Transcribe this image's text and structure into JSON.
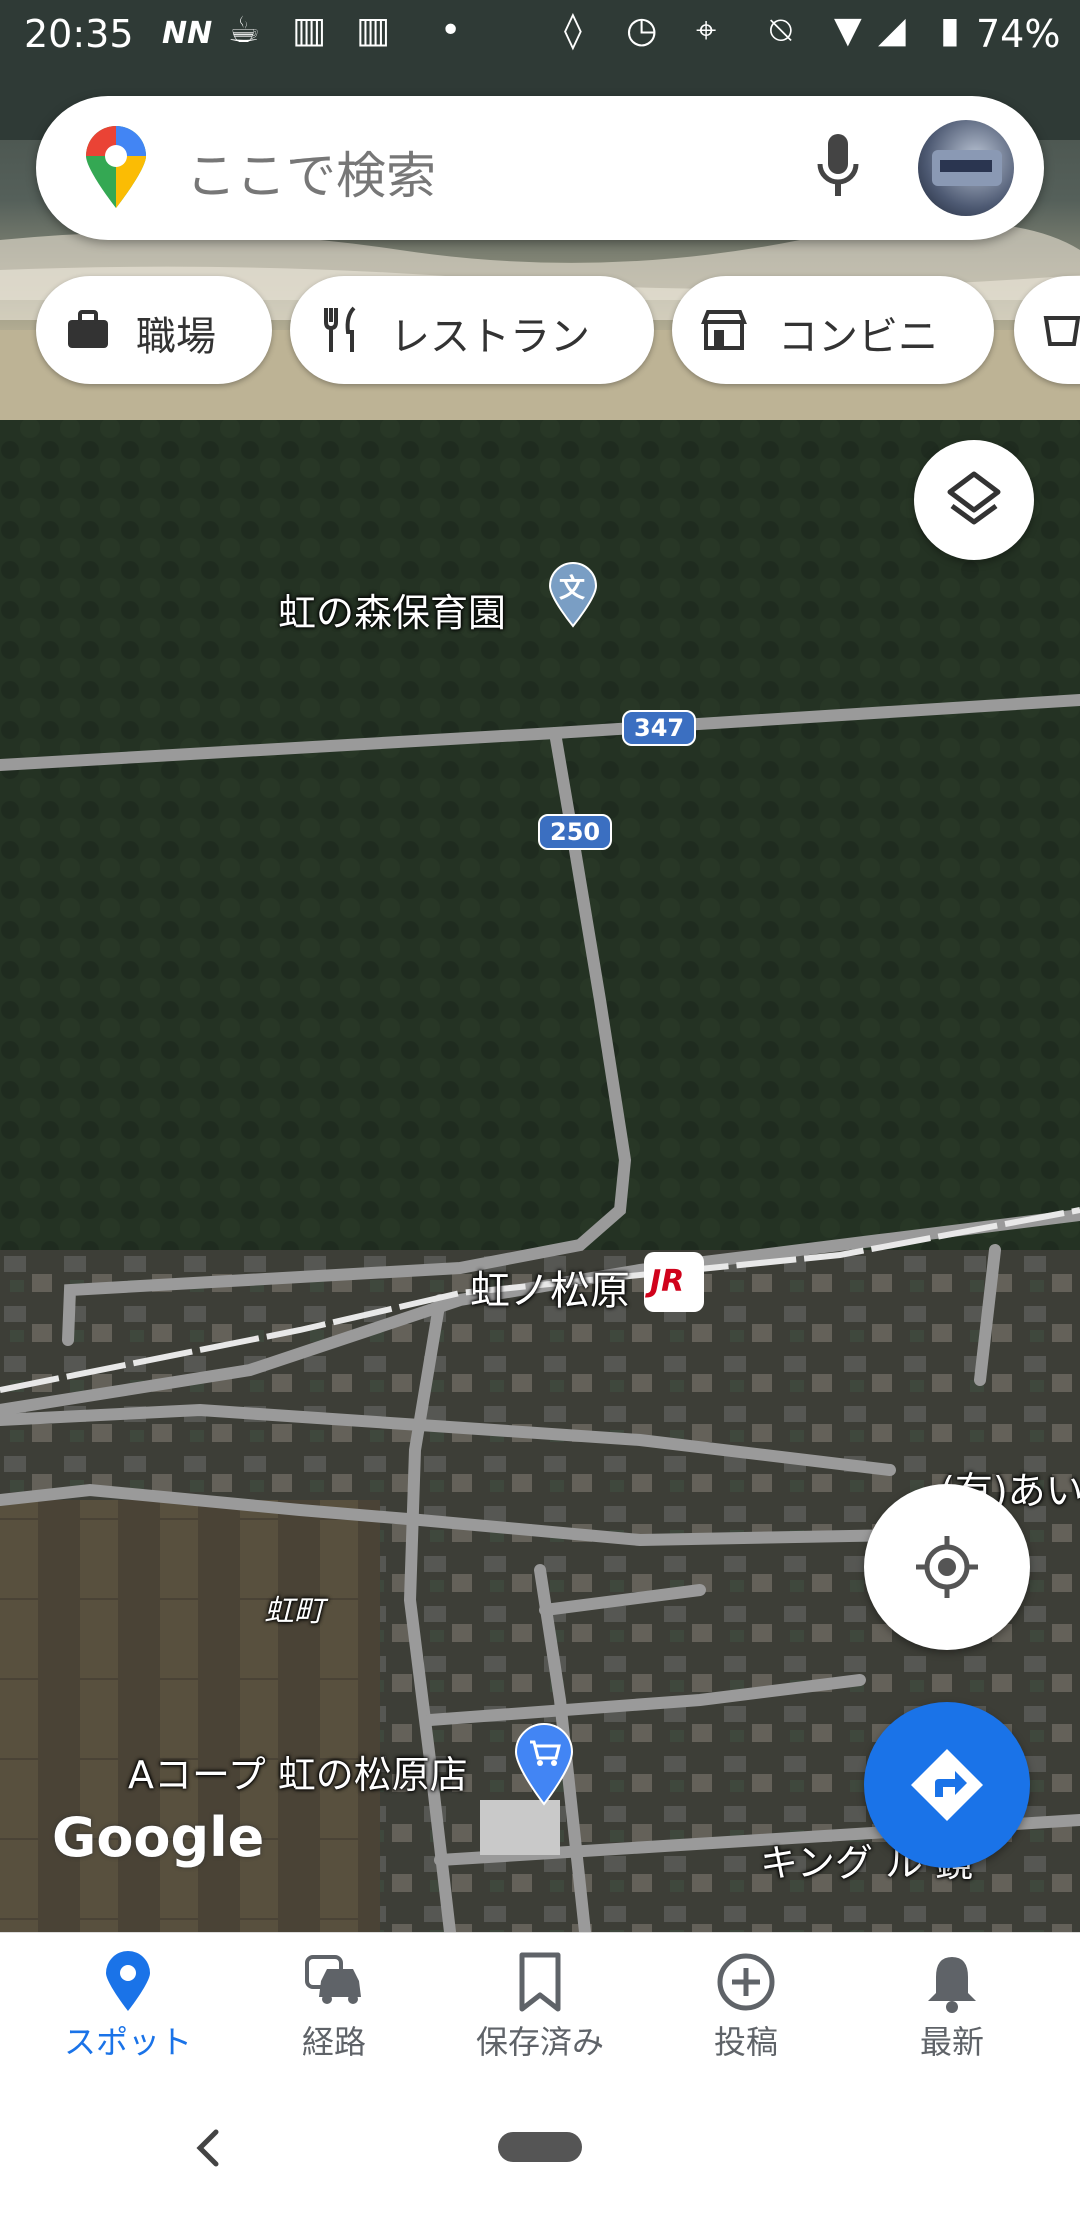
{
  "status_bar": {
    "time": "20:35",
    "battery": "74%",
    "left_icons": [
      "nnn-icon",
      "cup-icon",
      "bus-icon",
      "train-icon",
      "dot-icon"
    ],
    "right_icons": [
      "nfc-icon",
      "alarm-icon",
      "location-icon",
      "mute-icon",
      "wifi-icon",
      "signal-icon",
      "battery-icon"
    ]
  },
  "search": {
    "placeholder": "ここで検索"
  },
  "chips": [
    {
      "label": "職場",
      "icon": "briefcase-icon"
    },
    {
      "label": "レストラン",
      "icon": "fork-knife-icon"
    },
    {
      "label": "コンビニ",
      "icon": "store-icon"
    }
  ],
  "map": {
    "places": {
      "nursery": "虹の森保育園",
      "station": "虹ノ松原",
      "town": "虹町",
      "store": "Aコープ 虹の松原店",
      "company_partial": "(有)あい",
      "business_partial": "キング ル 鏡"
    },
    "route_shields": [
      "347",
      "250"
    ],
    "station_badge": "JR",
    "nursery_badge": "文",
    "watermark": "Google"
  },
  "bottom_nav": [
    {
      "label": "スポット",
      "icon": "location-pin-icon",
      "active": true
    },
    {
      "label": "経路",
      "icon": "car-icon",
      "active": false
    },
    {
      "label": "保存済み",
      "icon": "bookmark-icon",
      "active": false
    },
    {
      "label": "投稿",
      "icon": "add-circle-icon",
      "active": false
    },
    {
      "label": "最新",
      "icon": "bell-icon",
      "active": false
    }
  ],
  "colors": {
    "accent": "#1a73e8",
    "road": "#9a9a9a",
    "forest": "#23301f"
  }
}
